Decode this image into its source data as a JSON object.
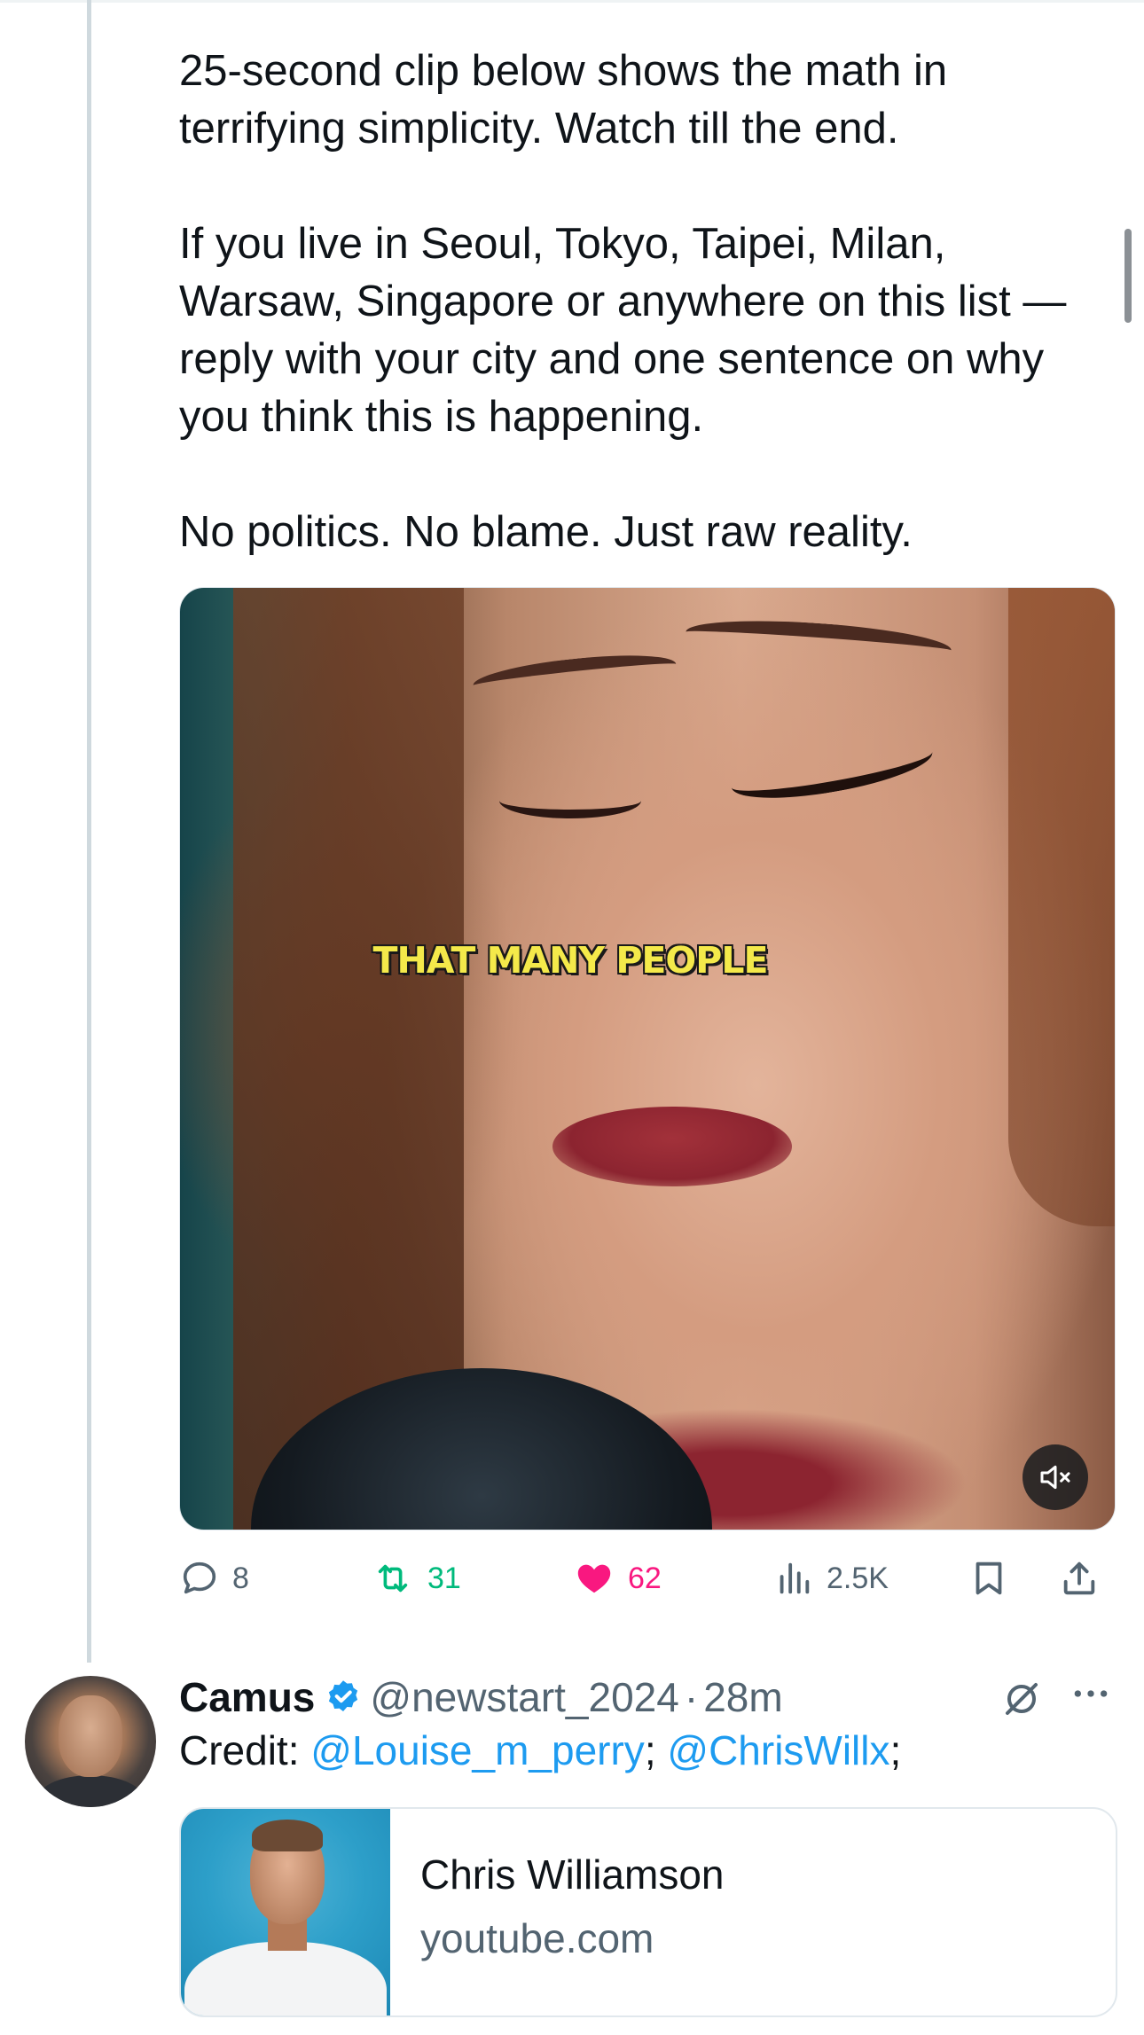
{
  "tweet": {
    "paragraphs": [
      "25-second clip below shows the math in\nterrifying simplicity. Watch till the end.",
      "If you live in Seoul, Tokyo, Taipei, Milan,\nWarsaw, Singapore or anywhere on this list —\nreply with your city and one sentence on why\nyou think this is happening.",
      "No politics. No blame. Just raw reality."
    ],
    "video_caption": "THAT MANY PEOPLE",
    "actions": {
      "replies": "8",
      "reposts": "31",
      "likes": "62",
      "views": "2.5K"
    }
  },
  "reply": {
    "name": "Camus",
    "handle": "@newstart_2024",
    "separator": "·",
    "time": "28m",
    "text_prefix": "Credit: ",
    "mention_1": "@Louise_m_perry",
    "text_mid": "; ",
    "mention_2": "@ChrisWillx",
    "text_suffix": ";",
    "card": {
      "title": "Chris Williamson",
      "domain": "youtube.com"
    }
  },
  "colors": {
    "text": "#0f1419",
    "secondary": "#536471",
    "link": "#1d9bf0",
    "retweet": "#00ba7c",
    "like": "#f91880",
    "thread_line": "#cfd9de"
  },
  "icons": [
    "reply-icon",
    "retweet-icon",
    "heart-icon",
    "views-icon",
    "bookmark-icon",
    "share-icon",
    "muted-speaker-icon",
    "verified-badge-icon",
    "grok-icon",
    "more-icon"
  ]
}
